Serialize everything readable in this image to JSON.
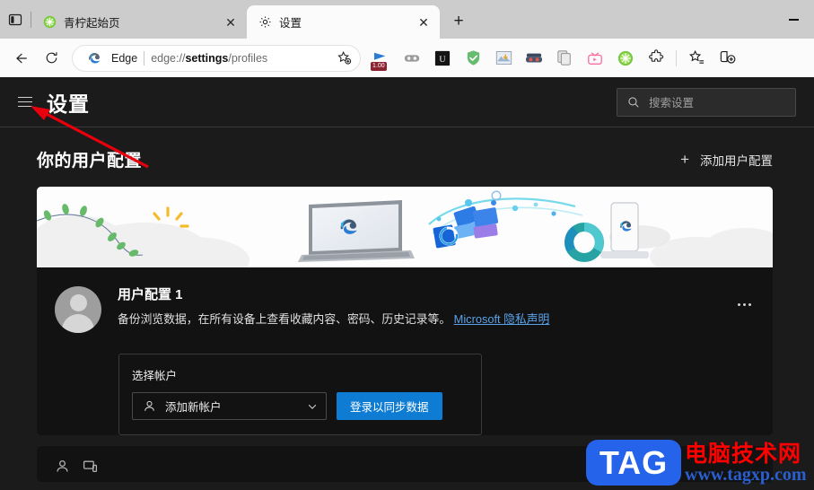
{
  "window": {
    "minimize_label": "—"
  },
  "tabstrip": {
    "tab_search_icon": "tab-actions-icon",
    "new_tab_label": "+",
    "tabs": [
      {
        "title": "青柠起始页",
        "favicon": "lime-icon",
        "close_label": "✕",
        "active": false
      },
      {
        "title": "设置",
        "favicon": "gear-icon",
        "close_label": "✕",
        "active": true
      }
    ]
  },
  "toolbar": {
    "back_icon": "back-arrow-icon",
    "refresh_icon": "refresh-icon",
    "omnibox": {
      "edge_label": "Edge",
      "url_prefix": "edge://",
      "url_bold": "settings",
      "url_suffix": "/profiles",
      "favorite_icon": "star-add-icon"
    },
    "extensions": [
      {
        "name": "video-speed-icon",
        "badge": "1.00"
      },
      {
        "name": "goggles-icon",
        "badge": ""
      },
      {
        "name": "letter-u-icon",
        "badge": ""
      },
      {
        "name": "adguard-shield-icon",
        "badge": ""
      },
      {
        "name": "image-download-icon",
        "badge": ""
      },
      {
        "name": "mask-avatar-icon",
        "badge": ""
      },
      {
        "name": "copy-pages-icon",
        "badge": ""
      },
      {
        "name": "tv-pink-icon",
        "badge": ""
      },
      {
        "name": "lime-icon",
        "badge": ""
      },
      {
        "name": "extensions-puzzle-icon",
        "badge": ""
      }
    ],
    "collections_icon": "collections-icon",
    "split_screen_icon": "split-screen-icon"
  },
  "settings": {
    "menu_icon": "hamburger-menu-icon",
    "title": "设置",
    "search": {
      "placeholder": "搜索设置",
      "icon": "search-icon"
    },
    "section": {
      "heading": "你的用户配置",
      "add_profile_label": "添加用户配置",
      "add_profile_icon": "plus-icon"
    },
    "profile_card": {
      "banner_icon": "sync-devices-illustration",
      "avatar_icon": "default-avatar-icon",
      "name": "用户配置 1",
      "description": "备份浏览数据，在所有设备上查看收藏内容、密码、历史记录等。",
      "privacy_link": "Microsoft 隐私声明",
      "more_icon": "more-options-icon",
      "signin": {
        "label": "选择帐户",
        "account_value": "添加新帐户",
        "account_icon": "person-icon",
        "chevron_icon": "chevron-down-icon",
        "button_label": "登录以同步数据"
      }
    }
  },
  "annotation": {
    "arrow_color": "#e8000d",
    "arrow_target": "hamburger-menu-icon"
  },
  "watermark": {
    "logo_text": "TAG",
    "site_name_cn": "电脑技术网",
    "site_url": "www.tagxp.com",
    "logo_bg": "#2563eb",
    "cn_color": "#ff0000",
    "url_color": "#2a5fd0"
  }
}
